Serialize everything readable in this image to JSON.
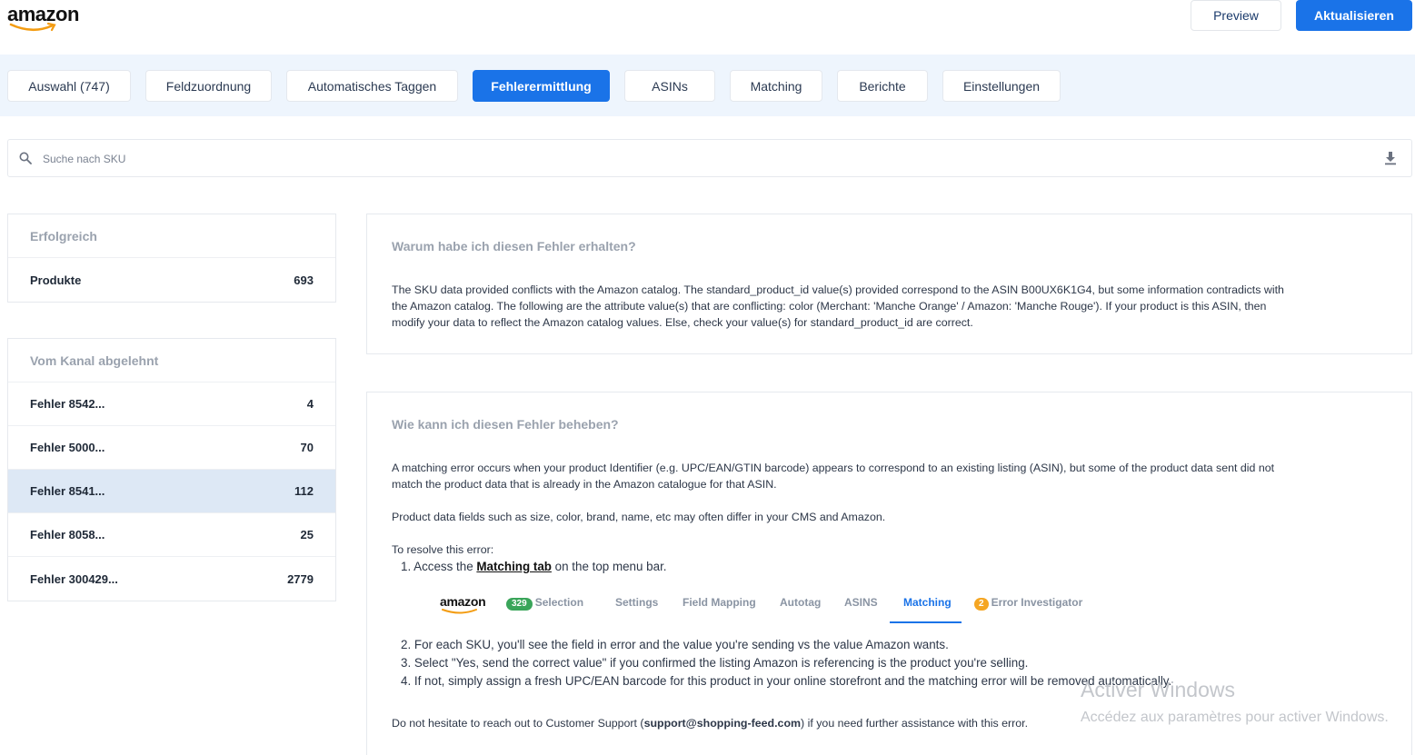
{
  "header": {
    "logo": "amazon",
    "preview_label": "Preview",
    "update_label": "Aktualisieren"
  },
  "tabs": [
    {
      "label": "Auswahl (747)"
    },
    {
      "label": "Feldzuordnung"
    },
    {
      "label": "Automatisches Taggen"
    },
    {
      "label": "Fehlerermittlung",
      "active": true
    },
    {
      "label": "ASINs"
    },
    {
      "label": "Matching"
    },
    {
      "label": "Berichte"
    },
    {
      "label": "Einstellungen"
    }
  ],
  "search": {
    "placeholder": "Suche nach SKU",
    "value": ""
  },
  "success_panel": {
    "title": "Erfolgreich",
    "rows": [
      {
        "label": "Produkte",
        "count": "693"
      }
    ]
  },
  "rejected_panel": {
    "title": "Vom Kanal abgelehnt",
    "rows": [
      {
        "label": "Fehler 8542...",
        "count": "4"
      },
      {
        "label": "Fehler 5000...",
        "count": "70"
      },
      {
        "label": "Fehler 8541...",
        "count": "112",
        "selected": true
      },
      {
        "label": "Fehler 8058...",
        "count": "25"
      },
      {
        "label": "Fehler 300429...",
        "count": "2779"
      }
    ]
  },
  "why_card": {
    "title": "Warum habe ich diesen Fehler erhalten?",
    "text": "The SKU data provided conflicts with the Amazon catalog. The standard_product_id value(s) provided correspond to the ASIN B00UX6K1G4, but some information contradicts with the Amazon catalog. The following are the attribute value(s) that are conflicting: color (Merchant: 'Manche Orange' / Amazon: 'Manche Rouge'). If your product is this ASIN, then modify your data to reflect the Amazon catalog values. Else, check your value(s) for standard_product_id are correct."
  },
  "how_card": {
    "title": "Wie kann ich diesen Fehler beheben?",
    "intro": "A matching error occurs when your product Identifier (e.g. UPC/EAN/GTIN barcode) appears to correspond to an existing listing (ASIN), but some of the product data sent did not match the product data that is already in the Amazon catalogue for that ASIN.",
    "fields_note": "Product data fields such as size, color, brand, name, etc may often differ in your CMS and Amazon.",
    "resolve_label": "To resolve this error:",
    "step1_prefix": "1. Access the ",
    "step1_link": "Matching tab",
    "step1_suffix": " on the top menu bar.",
    "step2": "2. For each SKU, you'll see the field in error and the value you're sending vs the value Amazon wants.",
    "step3": "3. Select \"Yes, send the correct value\" if you confirmed the listing Amazon is referencing is the product you're selling.",
    "step4": "4. If not, simply assign a fresh UPC/EAN barcode for this product in your online storefront and the matching error will be removed automatically.",
    "support_prefix": "Do not hesitate to reach out to Customer Support (",
    "support_email": "support@shopping-feed.com",
    "support_suffix": ") if you need further assistance with this error.",
    "mini_menu": {
      "logo": "amazon",
      "selection_badge": "329",
      "selection": "Selection",
      "settings": "Settings",
      "field_mapping": "Field Mapping",
      "autotag": "Autotag",
      "asins": "ASINS",
      "matching": "Matching",
      "error_badge": "2",
      "error_investigator": "Error Investigator"
    }
  },
  "watermark": {
    "title": "Activer Windows",
    "subtitle": "Accédez aux paramètres pour activer Windows."
  },
  "colors": {
    "accent": "#1a73e8",
    "tab_bar_bg": "#eef5fd",
    "selected_row": "#dde8f5"
  }
}
